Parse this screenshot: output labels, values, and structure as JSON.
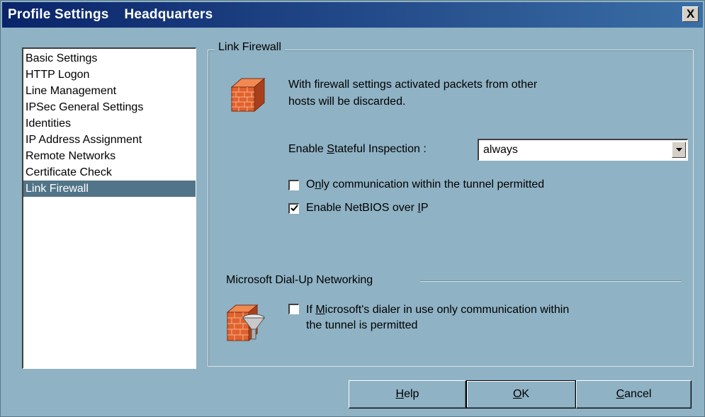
{
  "window": {
    "title": "Profile Settings    Headquarters",
    "close_label": "X"
  },
  "sidebar": {
    "items": [
      {
        "label": "Basic Settings"
      },
      {
        "label": "HTTP Logon"
      },
      {
        "label": "Line Management"
      },
      {
        "label": "IPSec General Settings"
      },
      {
        "label": "Identities"
      },
      {
        "label": "IP Address Assignment"
      },
      {
        "label": "Remote Networks"
      },
      {
        "label": "Certificate Check"
      },
      {
        "label": "Link Firewall",
        "selected": true
      }
    ]
  },
  "panel": {
    "group_title": "Link Firewall",
    "intro_line1": "With firewall settings activated packets from other",
    "intro_line2": "hosts will be discarded.",
    "stateful": {
      "label_pre": "Enable ",
      "label_key": "S",
      "label_post": "tateful Inspection :",
      "value": "always"
    },
    "only_tunnel": {
      "label_pre": "O",
      "label_key": "n",
      "label_post": "ly communication within the tunnel permitted",
      "checked": false
    },
    "netbios": {
      "label_pre": "Enable NetBIOS over ",
      "label_key": "I",
      "label_post": "P",
      "checked": true
    },
    "dialup_section": "Microsoft Dial-Up Networking",
    "dialer": {
      "line1_pre": "If ",
      "line1_key": "M",
      "line1_post": "icrosoft's dialer in use only communication within",
      "line2": "the tunnel is permitted",
      "checked": false
    },
    "icons": {
      "firewall": "brick-wall-icon",
      "dialup": "brick-wall-funnel-icon"
    },
    "colors": {
      "background": "#8fb2c4",
      "selection": "#527488",
      "brick": "#e0622e"
    }
  },
  "buttons": {
    "help": {
      "key": "H",
      "rest": "elp"
    },
    "ok": {
      "key": "O",
      "rest": "K"
    },
    "cancel": {
      "key": "C",
      "rest": "ancel"
    }
  }
}
